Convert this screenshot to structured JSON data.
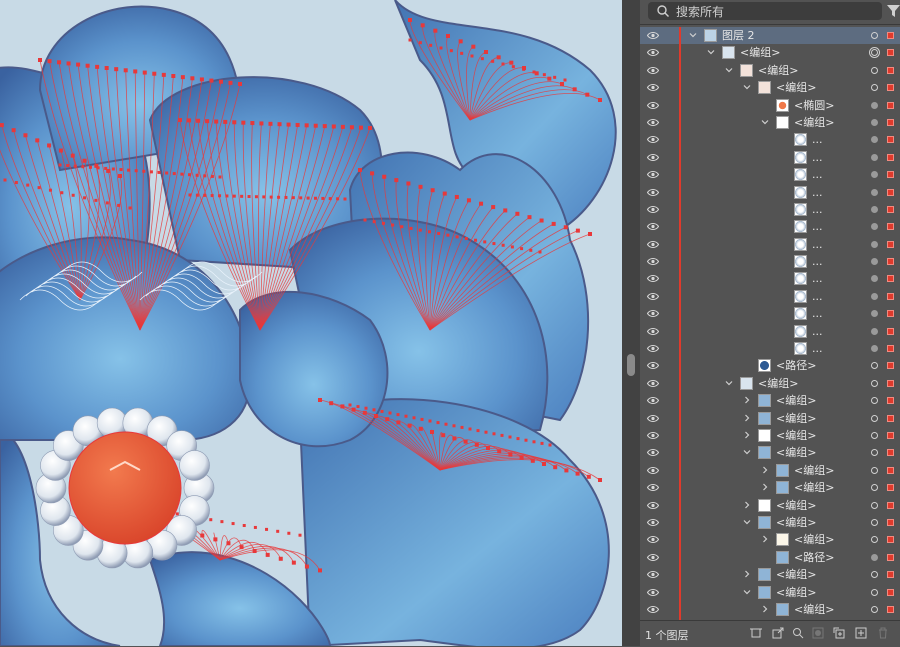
{
  "panel": {
    "search_placeholder": "搜索所有",
    "footer_count": "1 个图层",
    "icons": [
      "search-icon",
      "filter-icon",
      "eye-icon",
      "chevron-icon",
      "locate-object-icon",
      "export-icon",
      "find-icon",
      "mask-icon",
      "new-sublayer-icon",
      "new-layer-icon",
      "delete-icon"
    ],
    "rows": [
      {
        "name": "图层 2",
        "indent": 0,
        "twisty": "open",
        "thumb": "layer",
        "sel": true,
        "target": "circle",
        "select_mark": true
      },
      {
        "name": "<编组>",
        "indent": 1,
        "twisty": "open",
        "thumb": "group",
        "target": "double",
        "select_mark": true
      },
      {
        "name": "<编组>",
        "indent": 2,
        "twisty": "open",
        "thumb": "orange",
        "target": "circle",
        "select_mark": true
      },
      {
        "name": "<编组>",
        "indent": 3,
        "twisty": "open",
        "thumb": "orange",
        "target": "circle",
        "select_mark": true
      },
      {
        "name": "<椭圆>",
        "indent": 4,
        "twisty": "none",
        "thumb": "orangeball",
        "target": "fill",
        "select_mark": true
      },
      {
        "name": "<编组>",
        "indent": 4,
        "twisty": "open",
        "thumb": "white",
        "target": "fill",
        "select_mark": true
      },
      {
        "name": "...",
        "indent": 5,
        "twisty": "none",
        "thumb": "pearl",
        "target": "fill",
        "select_mark": true
      },
      {
        "name": "...",
        "indent": 5,
        "twisty": "none",
        "thumb": "pearl",
        "target": "fill",
        "select_mark": true
      },
      {
        "name": "...",
        "indent": 5,
        "twisty": "none",
        "thumb": "pearl",
        "target": "fill",
        "select_mark": true
      },
      {
        "name": "...",
        "indent": 5,
        "twisty": "none",
        "thumb": "pearl",
        "target": "fill",
        "select_mark": true
      },
      {
        "name": "...",
        "indent": 5,
        "twisty": "none",
        "thumb": "pearl",
        "target": "fill",
        "select_mark": true
      },
      {
        "name": "...",
        "indent": 5,
        "twisty": "none",
        "thumb": "pearl",
        "target": "fill",
        "select_mark": true
      },
      {
        "name": "...",
        "indent": 5,
        "twisty": "none",
        "thumb": "pearl",
        "target": "fill",
        "select_mark": true
      },
      {
        "name": "...",
        "indent": 5,
        "twisty": "none",
        "thumb": "pearl",
        "target": "fill",
        "select_mark": true
      },
      {
        "name": "...",
        "indent": 5,
        "twisty": "none",
        "thumb": "pearl",
        "target": "fill",
        "select_mark": true
      },
      {
        "name": "...",
        "indent": 5,
        "twisty": "none",
        "thumb": "pearl",
        "target": "fill",
        "select_mark": true
      },
      {
        "name": "...",
        "indent": 5,
        "twisty": "none",
        "thumb": "pearl",
        "target": "fill",
        "select_mark": true
      },
      {
        "name": "...",
        "indent": 5,
        "twisty": "none",
        "thumb": "pearl",
        "target": "fill",
        "select_mark": true
      },
      {
        "name": "...",
        "indent": 5,
        "twisty": "none",
        "thumb": "pearl",
        "target": "fill",
        "select_mark": true
      },
      {
        "name": "<路径>",
        "indent": 3,
        "twisty": "none",
        "thumb": "navy",
        "target": "circle",
        "select_mark": true
      },
      {
        "name": "<编组>",
        "indent": 2,
        "twisty": "open",
        "thumb": "group",
        "target": "circle",
        "select_mark": true
      },
      {
        "name": "<编组>",
        "indent": 3,
        "twisty": "closed",
        "thumb": "blue",
        "target": "circle",
        "select_mark": true
      },
      {
        "name": "<编组>",
        "indent": 3,
        "twisty": "closed",
        "thumb": "blue",
        "target": "circle",
        "select_mark": true
      },
      {
        "name": "<编组>",
        "indent": 3,
        "twisty": "closed",
        "thumb": "white",
        "target": "circle",
        "select_mark": true
      },
      {
        "name": "<编组>",
        "indent": 3,
        "twisty": "open",
        "thumb": "blue",
        "target": "circle",
        "select_mark": true
      },
      {
        "name": "<编组>",
        "indent": 4,
        "twisty": "closed",
        "thumb": "blue",
        "target": "circle",
        "select_mark": true
      },
      {
        "name": "<编组>",
        "indent": 4,
        "twisty": "closed",
        "thumb": "blue",
        "target": "circle",
        "select_mark": true
      },
      {
        "name": "<编组>",
        "indent": 3,
        "twisty": "closed",
        "thumb": "white",
        "target": "circle",
        "select_mark": true
      },
      {
        "name": "<编组>",
        "indent": 3,
        "twisty": "open",
        "thumb": "blue",
        "target": "circle",
        "select_mark": true
      },
      {
        "name": "<编组>",
        "indent": 4,
        "twisty": "closed",
        "thumb": "cream",
        "target": "circle",
        "select_mark": true
      },
      {
        "name": "<路径>",
        "indent": 4,
        "twisty": "none",
        "thumb": "blue",
        "target": "fill",
        "select_mark": true
      },
      {
        "name": "<编组>",
        "indent": 3,
        "twisty": "closed",
        "thumb": "blue",
        "target": "circle",
        "select_mark": true
      },
      {
        "name": "<编组>",
        "indent": 3,
        "twisty": "open",
        "thumb": "blue",
        "target": "circle",
        "select_mark": true
      },
      {
        "name": "<编组>",
        "indent": 4,
        "twisty": "closed",
        "thumb": "blue",
        "target": "circle",
        "select_mark": true
      },
      {
        "name": "<编组>",
        "indent": 4,
        "twisty": "closed",
        "thumb": "blue",
        "target": "circle",
        "select_mark": true
      }
    ]
  },
  "colors": {
    "canvas_bg": "#c8dae6",
    "petal_dark": "#3a66a3",
    "petal_light": "#7cb8e0",
    "outline": "#4a5a8a",
    "path_red": "#e8383a",
    "orange": "#e35a33",
    "panel_bg": "#535353",
    "selection_row": "#5d6c80"
  }
}
